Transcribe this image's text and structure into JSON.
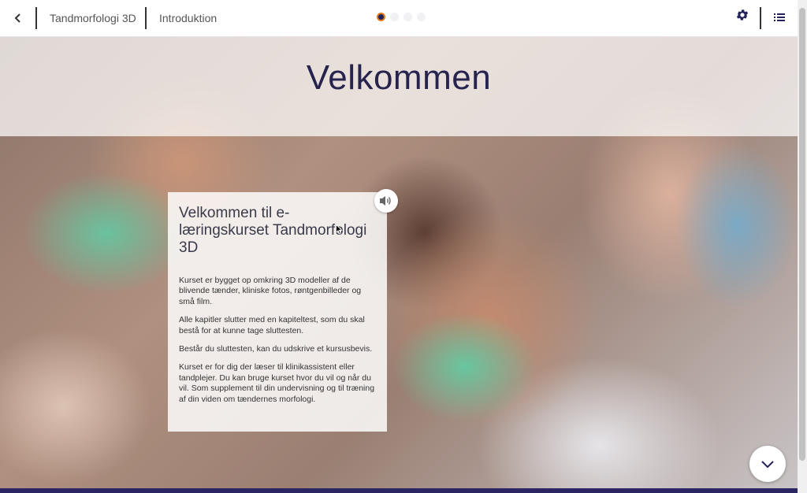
{
  "header": {
    "back_icon": "chevron-left-icon",
    "course_title": "Tandmorfologi 3D",
    "section_title": "Introduktion",
    "progress_dots_total": 4,
    "progress_dots_active": 1,
    "settings_icon": "gear-icon",
    "menu_icon": "list-icon"
  },
  "hero": {
    "title": "Velkommen",
    "background_description": "photo of dental professionals wearing masks looking down"
  },
  "card": {
    "heading": "Velkommen til e-læringskurset Tandmorfologi 3D",
    "paragraphs": [
      "Kurset er bygget op omkring 3D modeller af de blivende tænder, kliniske fotos, røntgenbilleder og små film.",
      "Alle kapitler slutter med en kapiteltest, som du skal bestå for at kunne tage sluttesten.",
      "Består du sluttesten, kan du udskrive et kursusbevis.",
      "Kurset er for dig der læser til klinikassistent eller tandplejer. Du kan bruge kurset hvor du vil og når du vil. Som supplement til din undervisning og til træning af din viden om tændernes morfologi."
    ],
    "audio_icon": "speaker-icon"
  },
  "scroll_down_icon": "chevron-down-icon",
  "colors": {
    "accent": "#24225a",
    "active_dot_ring": "#e07b1a",
    "title_text": "#27234f"
  }
}
